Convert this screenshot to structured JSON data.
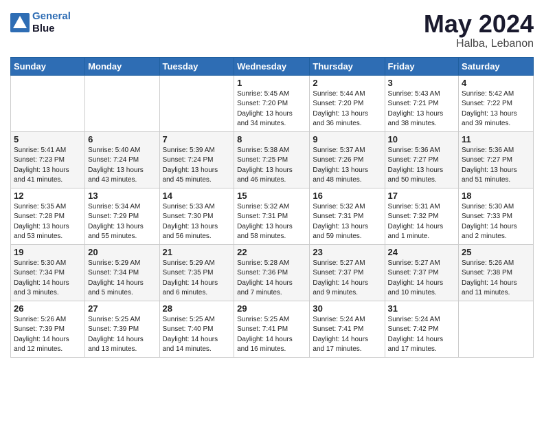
{
  "header": {
    "logo_line1": "General",
    "logo_line2": "Blue",
    "month_title": "May 2024",
    "location": "Halba, Lebanon"
  },
  "weekdays": [
    "Sunday",
    "Monday",
    "Tuesday",
    "Wednesday",
    "Thursday",
    "Friday",
    "Saturday"
  ],
  "weeks": [
    [
      {
        "day": "",
        "info": ""
      },
      {
        "day": "",
        "info": ""
      },
      {
        "day": "",
        "info": ""
      },
      {
        "day": "1",
        "info": "Sunrise: 5:45 AM\nSunset: 7:20 PM\nDaylight: 13 hours\nand 34 minutes."
      },
      {
        "day": "2",
        "info": "Sunrise: 5:44 AM\nSunset: 7:20 PM\nDaylight: 13 hours\nand 36 minutes."
      },
      {
        "day": "3",
        "info": "Sunrise: 5:43 AM\nSunset: 7:21 PM\nDaylight: 13 hours\nand 38 minutes."
      },
      {
        "day": "4",
        "info": "Sunrise: 5:42 AM\nSunset: 7:22 PM\nDaylight: 13 hours\nand 39 minutes."
      }
    ],
    [
      {
        "day": "5",
        "info": "Sunrise: 5:41 AM\nSunset: 7:23 PM\nDaylight: 13 hours\nand 41 minutes."
      },
      {
        "day": "6",
        "info": "Sunrise: 5:40 AM\nSunset: 7:24 PM\nDaylight: 13 hours\nand 43 minutes."
      },
      {
        "day": "7",
        "info": "Sunrise: 5:39 AM\nSunset: 7:24 PM\nDaylight: 13 hours\nand 45 minutes."
      },
      {
        "day": "8",
        "info": "Sunrise: 5:38 AM\nSunset: 7:25 PM\nDaylight: 13 hours\nand 46 minutes."
      },
      {
        "day": "9",
        "info": "Sunrise: 5:37 AM\nSunset: 7:26 PM\nDaylight: 13 hours\nand 48 minutes."
      },
      {
        "day": "10",
        "info": "Sunrise: 5:36 AM\nSunset: 7:27 PM\nDaylight: 13 hours\nand 50 minutes."
      },
      {
        "day": "11",
        "info": "Sunrise: 5:36 AM\nSunset: 7:27 PM\nDaylight: 13 hours\nand 51 minutes."
      }
    ],
    [
      {
        "day": "12",
        "info": "Sunrise: 5:35 AM\nSunset: 7:28 PM\nDaylight: 13 hours\nand 53 minutes."
      },
      {
        "day": "13",
        "info": "Sunrise: 5:34 AM\nSunset: 7:29 PM\nDaylight: 13 hours\nand 55 minutes."
      },
      {
        "day": "14",
        "info": "Sunrise: 5:33 AM\nSunset: 7:30 PM\nDaylight: 13 hours\nand 56 minutes."
      },
      {
        "day": "15",
        "info": "Sunrise: 5:32 AM\nSunset: 7:31 PM\nDaylight: 13 hours\nand 58 minutes."
      },
      {
        "day": "16",
        "info": "Sunrise: 5:32 AM\nSunset: 7:31 PM\nDaylight: 13 hours\nand 59 minutes."
      },
      {
        "day": "17",
        "info": "Sunrise: 5:31 AM\nSunset: 7:32 PM\nDaylight: 14 hours\nand 1 minute."
      },
      {
        "day": "18",
        "info": "Sunrise: 5:30 AM\nSunset: 7:33 PM\nDaylight: 14 hours\nand 2 minutes."
      }
    ],
    [
      {
        "day": "19",
        "info": "Sunrise: 5:30 AM\nSunset: 7:34 PM\nDaylight: 14 hours\nand 3 minutes."
      },
      {
        "day": "20",
        "info": "Sunrise: 5:29 AM\nSunset: 7:34 PM\nDaylight: 14 hours\nand 5 minutes."
      },
      {
        "day": "21",
        "info": "Sunrise: 5:29 AM\nSunset: 7:35 PM\nDaylight: 14 hours\nand 6 minutes."
      },
      {
        "day": "22",
        "info": "Sunrise: 5:28 AM\nSunset: 7:36 PM\nDaylight: 14 hours\nand 7 minutes."
      },
      {
        "day": "23",
        "info": "Sunrise: 5:27 AM\nSunset: 7:37 PM\nDaylight: 14 hours\nand 9 minutes."
      },
      {
        "day": "24",
        "info": "Sunrise: 5:27 AM\nSunset: 7:37 PM\nDaylight: 14 hours\nand 10 minutes."
      },
      {
        "day": "25",
        "info": "Sunrise: 5:26 AM\nSunset: 7:38 PM\nDaylight: 14 hours\nand 11 minutes."
      }
    ],
    [
      {
        "day": "26",
        "info": "Sunrise: 5:26 AM\nSunset: 7:39 PM\nDaylight: 14 hours\nand 12 minutes."
      },
      {
        "day": "27",
        "info": "Sunrise: 5:25 AM\nSunset: 7:39 PM\nDaylight: 14 hours\nand 13 minutes."
      },
      {
        "day": "28",
        "info": "Sunrise: 5:25 AM\nSunset: 7:40 PM\nDaylight: 14 hours\nand 14 minutes."
      },
      {
        "day": "29",
        "info": "Sunrise: 5:25 AM\nSunset: 7:41 PM\nDaylight: 14 hours\nand 16 minutes."
      },
      {
        "day": "30",
        "info": "Sunrise: 5:24 AM\nSunset: 7:41 PM\nDaylight: 14 hours\nand 17 minutes."
      },
      {
        "day": "31",
        "info": "Sunrise: 5:24 AM\nSunset: 7:42 PM\nDaylight: 14 hours\nand 17 minutes."
      },
      {
        "day": "",
        "info": ""
      }
    ]
  ]
}
